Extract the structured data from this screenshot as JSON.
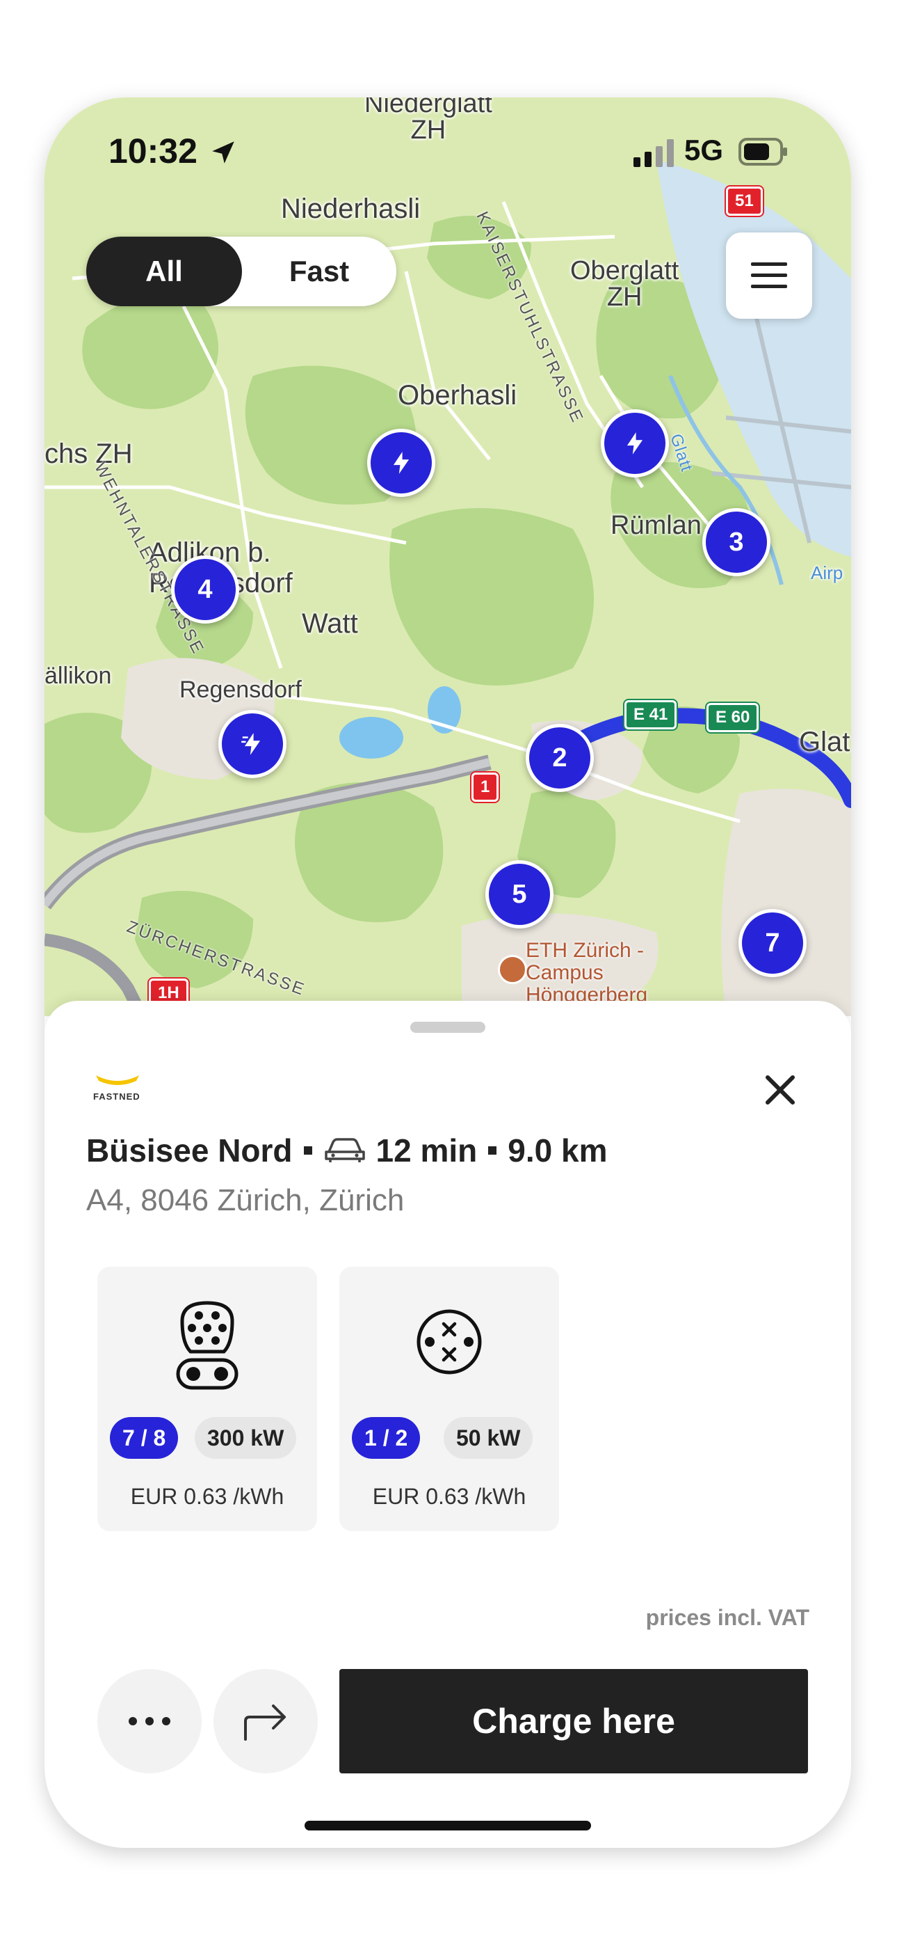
{
  "status_bar": {
    "time": "10:32",
    "network": "5G"
  },
  "filter": {
    "options": [
      "All",
      "Fast"
    ],
    "selected": "All"
  },
  "map": {
    "places": {
      "niederglatt": "Niederglatt\nZH",
      "niederhasli": "Niederhasli",
      "oberglatt": "Oberglatt\nZH",
      "oberhasli": "Oberhasli",
      "chs_zh": "chs ZH",
      "rumlang": "Rümlan",
      "adlikon": "Adlikon b.\nRegensdorf",
      "watt": "Watt",
      "allikon": "ällikon",
      "regensdorf": "Regensdorf",
      "glatt_city": "Glat",
      "airport": "Airp"
    },
    "streets": {
      "wehntaler": "WEHNTALERSTRASSE",
      "kaiserstuhl": "KAISERSTUHLSTRASSE",
      "zurcher": "ZÜRCHERSTRASSE",
      "glatt_river": "Glatt"
    },
    "poi": {
      "eth": "ETH Zürich -\nCampus\nHönggerberg"
    },
    "road_badges": {
      "r51": "51",
      "r1": "1",
      "r1h": "1H",
      "e41": "E 41",
      "e60": "E 60"
    },
    "markers": {
      "m4": "4",
      "m3": "3",
      "m2": "2",
      "m5": "5",
      "m7": "7"
    }
  },
  "station": {
    "brand": "FASTNED",
    "name": "Büsisee Nord",
    "drive_time": "12 min",
    "distance": "9.0 km",
    "address": "A4, 8046 Zürich, Zürich",
    "connectors": [
      {
        "type": "ccs-connector-icon",
        "available": "7 / 8",
        "power": "300 kW",
        "price": "EUR 0.63 /kWh"
      },
      {
        "type": "chademo-connector-icon",
        "available": "1 / 2",
        "power": "50 kW",
        "price": "EUR 0.63 /kWh"
      }
    ],
    "vat_note": "prices incl. VAT",
    "charge_label": "Charge here"
  },
  "colors": {
    "marker": "#2723d8",
    "route": "#2b3be0",
    "button_dark": "#222222"
  }
}
